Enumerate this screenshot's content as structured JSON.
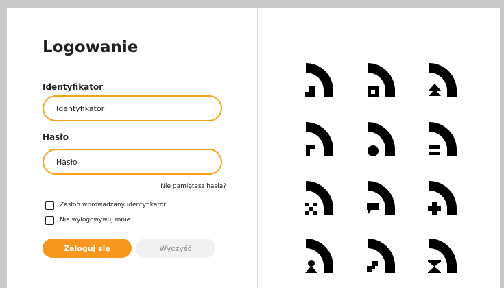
{
  "login": {
    "title": "Logowanie",
    "identifier_label": "Identyfikator",
    "identifier_placeholder": "Identyfikator",
    "password_label": "Hasło",
    "password_placeholder": "Hasło",
    "forgot_password": "Nie pamiętasz hasła?",
    "mask_identifier_label": "Zasłoń wprowadzany identyfikator",
    "stay_logged_in_label": "Nie wylogowywuj mnie",
    "login_button": "Zaloguj się",
    "clear_button": "Wyczyść"
  },
  "colors": {
    "accent": "#f8971d",
    "field_border": "#f7a11a",
    "icon": "#000000"
  },
  "security_icons": [
    "arc-stair-icon",
    "arc-square-icon",
    "arc-double-chevron-icon",
    "arc-flag-icon",
    "arc-dot-icon",
    "arc-equals-icon",
    "arc-cross-pattern-icon",
    "arc-speech-bubble-icon",
    "arc-plus-icon",
    "arc-person-icon",
    "arc-checker-icon",
    "arc-hourglass-icon"
  ]
}
